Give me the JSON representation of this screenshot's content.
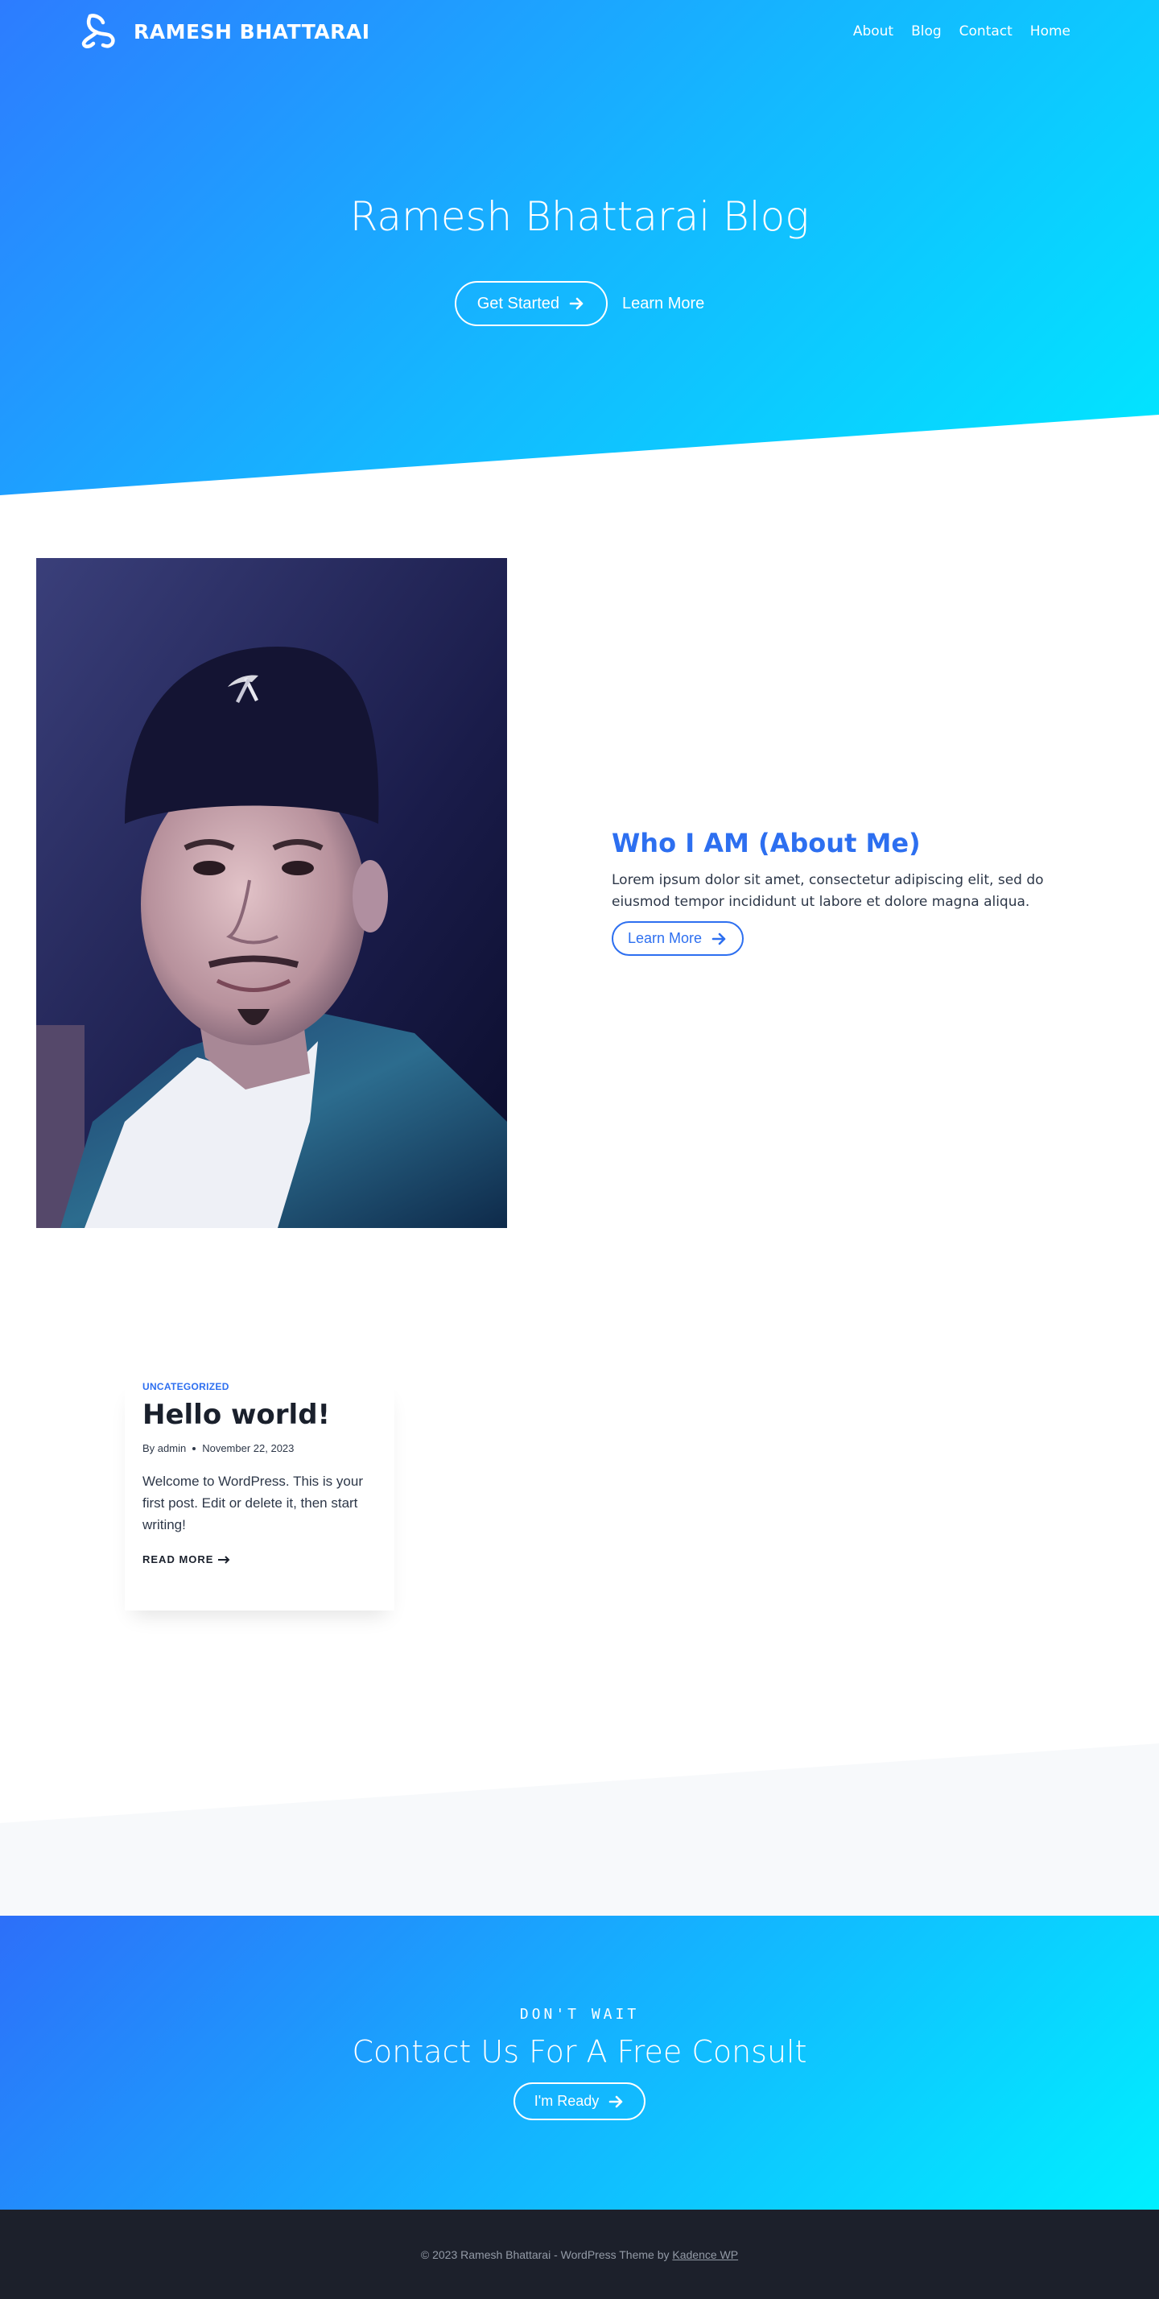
{
  "brand": {
    "name": "RAMESH BHATTARAI",
    "logo_icon": "triskelion-logo-icon"
  },
  "nav": {
    "items": [
      "About",
      "Blog",
      "Contact",
      "Home"
    ]
  },
  "hero": {
    "title": "Ramesh Bhattarai Blog",
    "primary_button": "Get Started",
    "secondary_link": "Learn More"
  },
  "about": {
    "title": "Who I AM (About Me)",
    "body": "Lorem ipsum dolor sit amet, consectetur adipiscing elit, sed do eiusmod tempor incididunt ut labore et dolore magna aliqua.",
    "button": "Learn More",
    "photo_alt": "Portrait photo"
  },
  "post": {
    "category": "UNCATEGORIZED",
    "title": "Hello world!",
    "author": "By admin",
    "date": "November 22, 2023",
    "excerpt": "Welcome to WordPress. This is your first post. Edit or delete it, then start writing!",
    "read_more": "READ MORE"
  },
  "cta": {
    "eyebrow": "DON'T WAIT",
    "title": "Contact Us For A Free Consult",
    "button": "I'm Ready"
  },
  "footer": {
    "text": "© 2023 Ramesh Bhattarai - WordPress Theme by",
    "link": "Kadence WP"
  },
  "colors": {
    "accent": "#2d6ff0",
    "hero_start": "#2d7cff",
    "hero_end": "#00e8ff",
    "footer_bg": "#1c202b",
    "gray_band": "#f7f9fb"
  }
}
